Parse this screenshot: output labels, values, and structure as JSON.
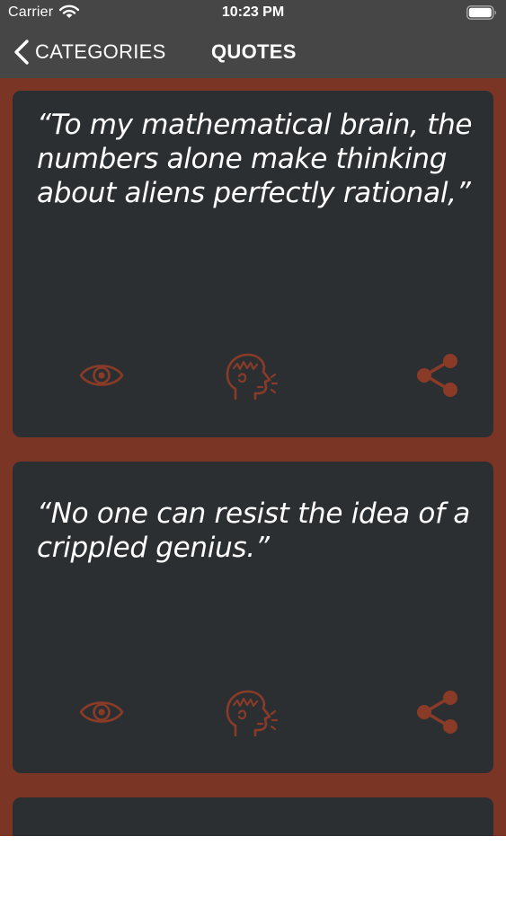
{
  "status_bar": {
    "carrier": "Carrier",
    "time": "10:23 PM"
  },
  "nav": {
    "back_label": "CATEGORIES",
    "title": "QUOTES"
  },
  "quotes": [
    {
      "text": "“To my mathematical brain, the numbers alone make thinking about aliens perfectly rational,”"
    },
    {
      "text": "“No one can resist the idea of a crippled genius.”"
    },
    {
      "text": ""
    }
  ],
  "icons": {
    "view": "eye-icon",
    "speak": "speaking-head-icon",
    "share": "share-icon",
    "back": "chevron-left-icon",
    "wifi": "wifi-icon",
    "battery": "battery-icon"
  },
  "colors": {
    "background": "#7a3525",
    "topbar": "#464646",
    "card": "#2c2f32",
    "accent": "#8a3b28",
    "text": "#ffffff"
  }
}
